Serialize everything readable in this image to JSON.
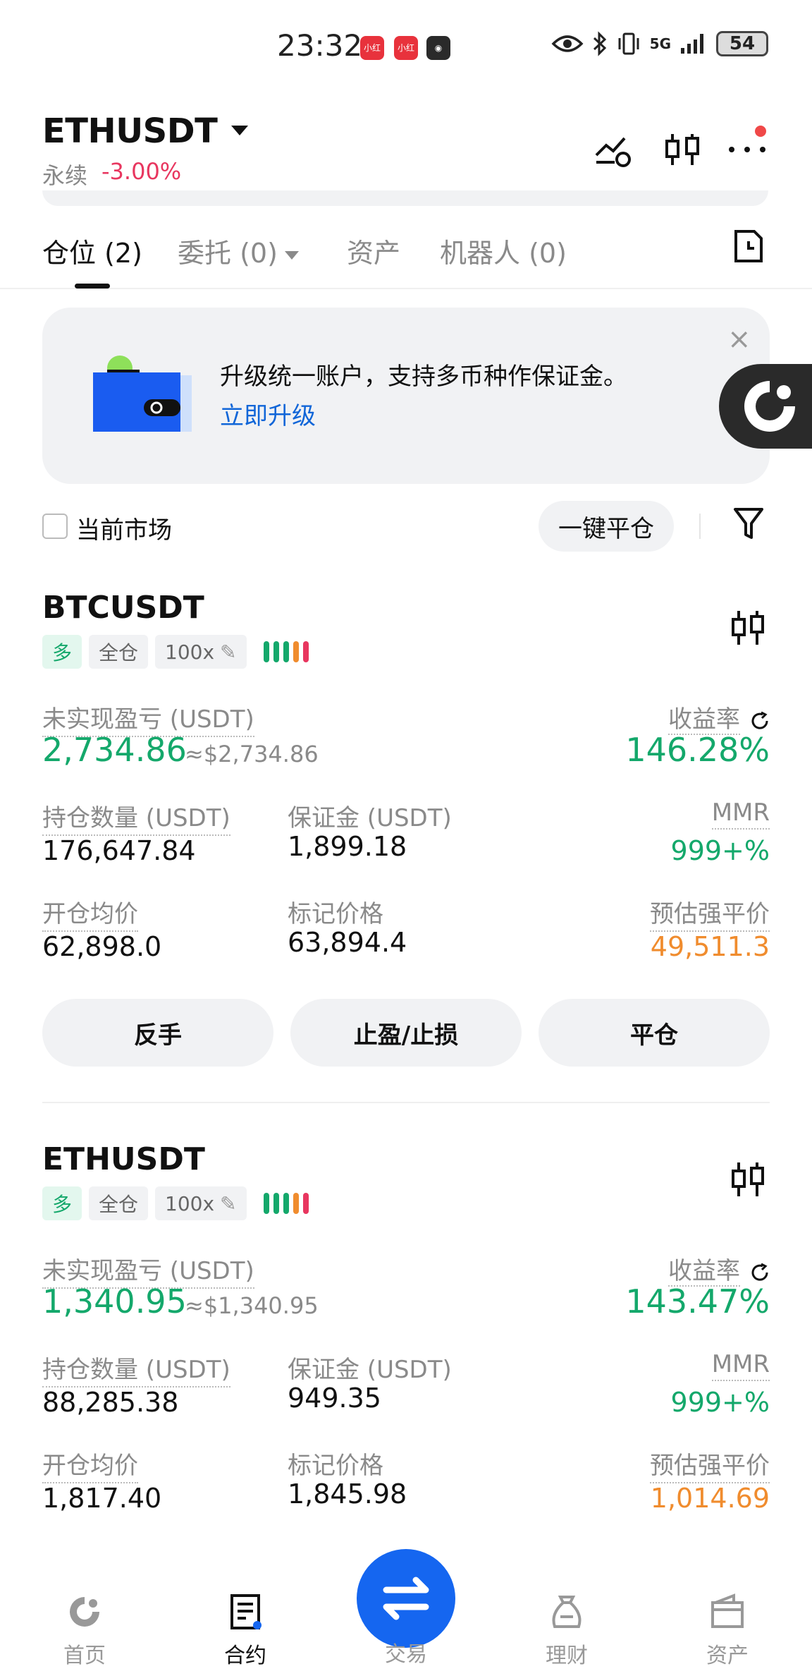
{
  "status_bar": {
    "time": "23:32",
    "network": "5G",
    "battery": "54"
  },
  "header": {
    "pair": "ETHUSDT",
    "type": "永续",
    "change": "-3.00%"
  },
  "tabs": [
    {
      "label": "仓位 (2)"
    },
    {
      "label": "委托 (0)"
    },
    {
      "label": "资产"
    },
    {
      "label": "机器人 (0)"
    }
  ],
  "banner": {
    "text": "升级统一账户，支持多币种作保证金。",
    "link": "立即升级"
  },
  "filter": {
    "checkbox_label": "当前市场",
    "close_all": "一键平仓"
  },
  "labels": {
    "unrealized": "未实现盈亏 (USDT)",
    "roi": "收益率",
    "size": "持仓数量 (USDT)",
    "margin": "保证金 (USDT)",
    "mmr": "MMR",
    "entry": "开仓均价",
    "mark": "标记价格",
    "liq": "预估强平价"
  },
  "positions": [
    {
      "symbol": "BTCUSDT",
      "side": "多",
      "margin_mode": "全仓",
      "leverage": "100x",
      "unrealized_pnl": "2,734.86",
      "unrealized_usd": "≈$2,734.86",
      "roi": "146.28%",
      "size": "176,647.84",
      "margin": "1,899.18",
      "mmr": "999+%",
      "entry_price": "62,898.0",
      "mark_price": "63,894.4",
      "liq_price": "49,511.3",
      "actions": [
        "反手",
        "止盈/止损",
        "平仓"
      ]
    },
    {
      "symbol": "ETHUSDT",
      "side": "多",
      "margin_mode": "全仓",
      "leverage": "100x",
      "unrealized_pnl": "1,340.95",
      "unrealized_usd": "≈$1,340.95",
      "roi": "143.47%",
      "size": "88,285.38",
      "margin": "949.35",
      "mmr": "999+%",
      "entry_price": "1,817.40",
      "mark_price": "1,845.98",
      "liq_price": "1,014.69"
    }
  ],
  "bottom_nav": [
    {
      "label": "首页",
      "icon": "home-icon"
    },
    {
      "label": "合约",
      "icon": "futures-icon"
    },
    {
      "label": "交易",
      "icon": "trade-swap-icon"
    },
    {
      "label": "理财",
      "icon": "earn-icon"
    },
    {
      "label": "资产",
      "icon": "wallet-icon"
    }
  ],
  "colors": {
    "green": "#14a86b",
    "red": "#e8365f",
    "orange": "#f08c2e",
    "blue": "#1566f0",
    "link": "#1166d8"
  }
}
